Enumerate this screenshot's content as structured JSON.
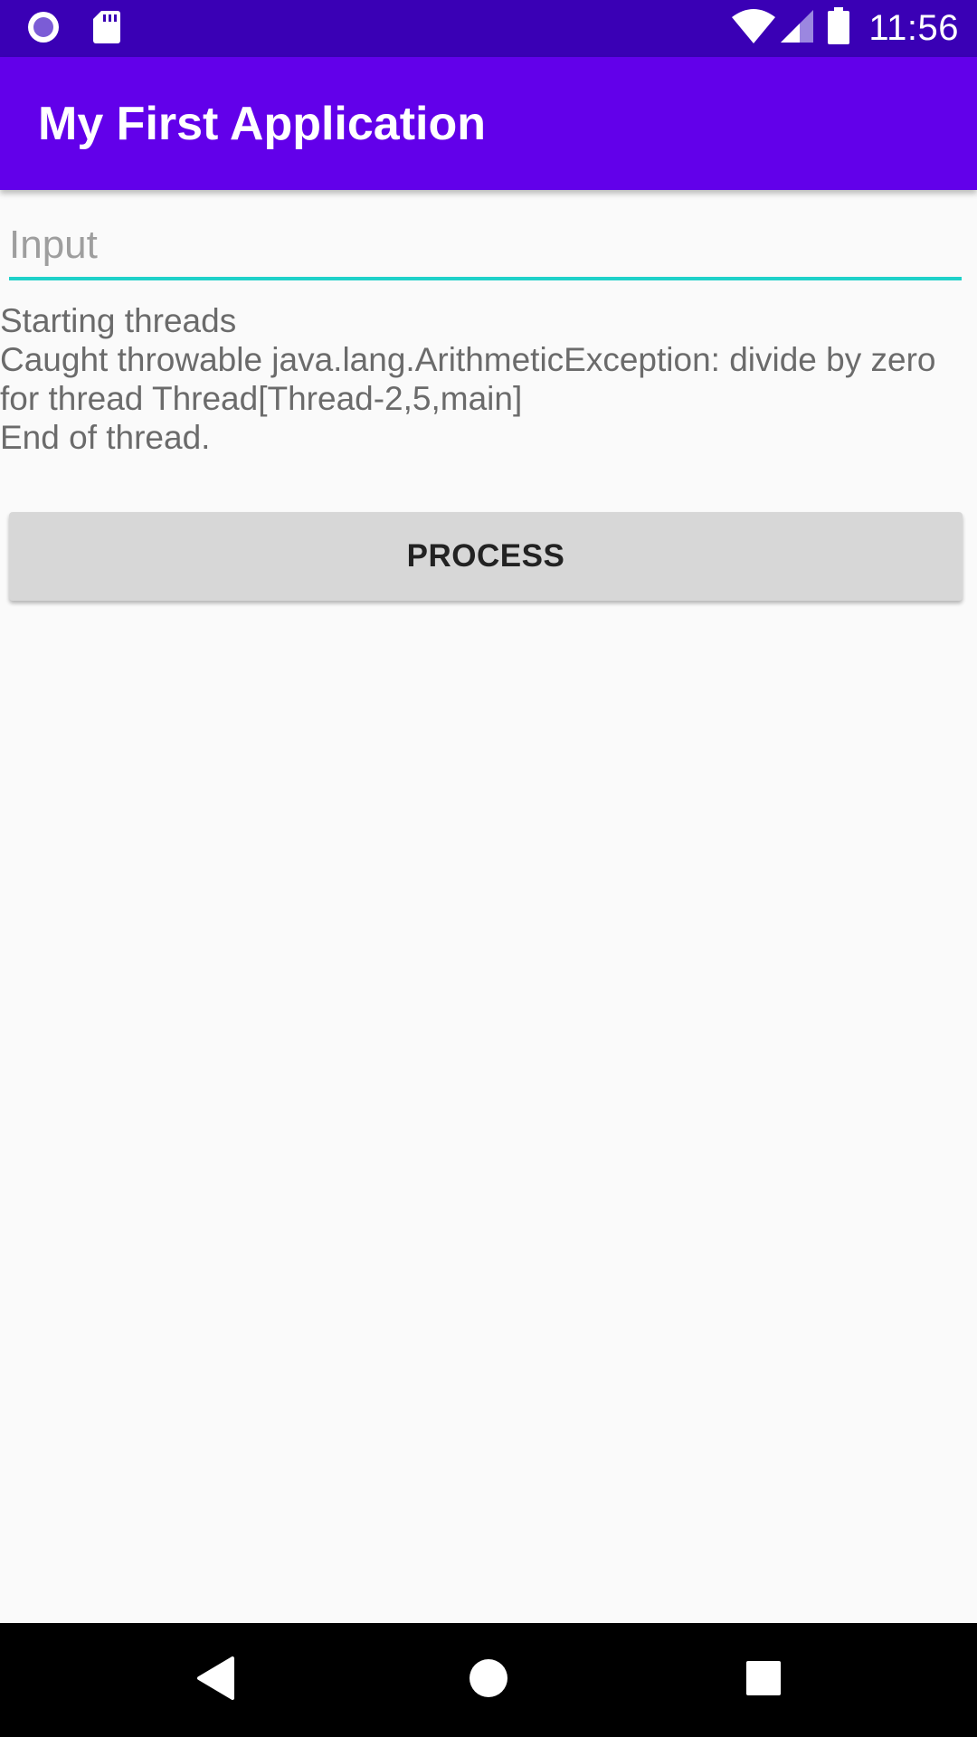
{
  "status_bar": {
    "time": "11:56",
    "left_icons": [
      "app-notification-icon",
      "sd-card-icon"
    ],
    "right_icons": [
      "wifi-icon",
      "cell-signal-icon",
      "battery-icon"
    ],
    "background_color": "#3a00b5"
  },
  "app_bar": {
    "title": "My First Application",
    "background_color": "#6200ea"
  },
  "input": {
    "placeholder": "Input",
    "value": "",
    "underline_color": "#1fd1c9"
  },
  "output": {
    "lines": [
      "Starting threads",
      "Caught throwable java.lang.ArithmeticException: divide by zero",
      "for thread Thread[Thread-2,5,main]",
      "End of thread."
    ]
  },
  "button": {
    "label": "PROCESS"
  },
  "nav_bar": {
    "buttons": [
      "back-icon",
      "home-icon",
      "recents-icon"
    ]
  }
}
